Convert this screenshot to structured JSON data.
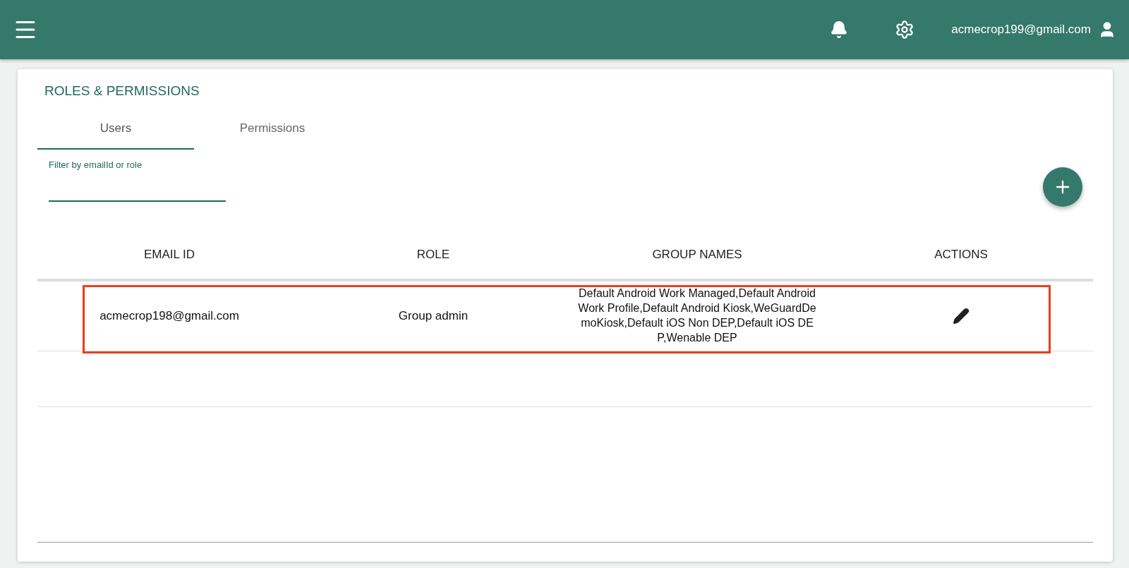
{
  "header": {
    "user_email": "acmecrop199@gmail.com"
  },
  "page": {
    "title": "ROLES & PERMISSIONS"
  },
  "tabs": [
    {
      "label": "Users",
      "selected": true
    },
    {
      "label": "Permissions",
      "selected": false
    }
  ],
  "filter": {
    "placeholder": "Filter by emailId or role"
  },
  "table": {
    "columns": [
      "EMAIL ID",
      "ROLE",
      "GROUP NAMES",
      "ACTIONS"
    ],
    "rows": [
      {
        "email": "acmecrop198@gmail.com",
        "role": "Group admin",
        "groups": "Default Android Work Managed,Default Android Work Profile,Default Android Kiosk,WeGuardDemoKiosk,Default iOS Non DEP,Default iOS DEP,Wenable DEP",
        "highlighted": true
      }
    ]
  }
}
